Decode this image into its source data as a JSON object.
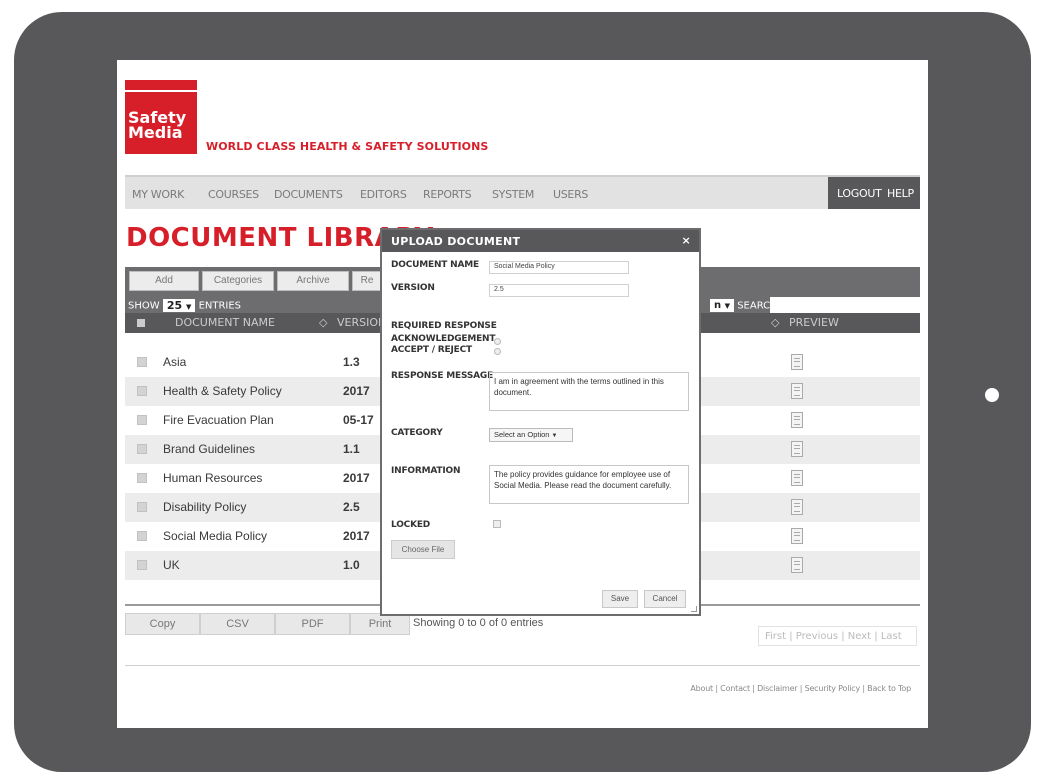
{
  "brand": {
    "logo_line1": "Safety",
    "logo_line2": "Media",
    "tagline": "WORLD CLASS HEALTH & SAFETY SOLUTIONS",
    "accent": "#d71f2a"
  },
  "nav": {
    "items": [
      "MY WORK",
      "COURSES",
      "DOCUMENTS",
      "EDITORS",
      "REPORTS",
      "SYSTEM",
      "USERS"
    ],
    "logout": "LOGOUT",
    "help": "HELP"
  },
  "page": {
    "title": "DOCUMENT LIBRARY"
  },
  "toolbar": {
    "buttons": [
      "Add",
      "Categories",
      "Archive",
      "Re"
    ],
    "show_label": "SHOW",
    "show_value": "25",
    "entries_label": "ENTRIES",
    "filter_partial": "n",
    "search_label": "SEARCH:"
  },
  "table": {
    "columns": {
      "name": "DOCUMENT NAME",
      "version": "VERSION",
      "preview": "PREVIEW"
    },
    "rows": [
      {
        "name": "Asia",
        "version": "1.3"
      },
      {
        "name": "Health & Safety Policy",
        "version": "2017"
      },
      {
        "name": "Fire Evacuation Plan",
        "version": "05-17"
      },
      {
        "name": "Brand Guidelines",
        "version": "1.1"
      },
      {
        "name": "Human Resources",
        "version": "2017"
      },
      {
        "name": "Disability Policy",
        "version": "2.5"
      },
      {
        "name": "Social Media Policy",
        "version": "2017"
      },
      {
        "name": "UK",
        "version": "1.0"
      }
    ]
  },
  "export": {
    "copy": "Copy",
    "csv": "CSV",
    "pdf": "PDF",
    "print": "Print"
  },
  "info": {
    "showing": "Showing 0 to 0 of 0 entries"
  },
  "pager": {
    "first": "First",
    "previous": "Previous",
    "next": "Next",
    "last": "Last"
  },
  "footer": {
    "links": "About | Contact | Disclaimer | Security Policy | Back to Top"
  },
  "modal": {
    "title": "UPLOAD DOCUMENT",
    "close": "×",
    "doc_name_label": "DOCUMENT NAME",
    "doc_name_value": "Social Media Policy",
    "version_label": "VERSION",
    "version_value": "2.5",
    "required_response_label": "REQUIRED RESPONSE",
    "ack_label": "ACKNOWLEDGEMENT",
    "accept_label": "ACCEPT / REJECT",
    "response_label": "RESPONSE MESSAGE",
    "response_value": "I am in agreement with the terms outlined in this document.",
    "category_label": "CATEGORY",
    "category_value": "Select an Option",
    "information_label": "INFORMATION",
    "information_value": "The policy provides guidance for employee use of Social Media. Please read the document carefully.",
    "locked_label": "LOCKED",
    "choose_file": "Choose File",
    "save": "Save",
    "cancel": "Cancel"
  }
}
